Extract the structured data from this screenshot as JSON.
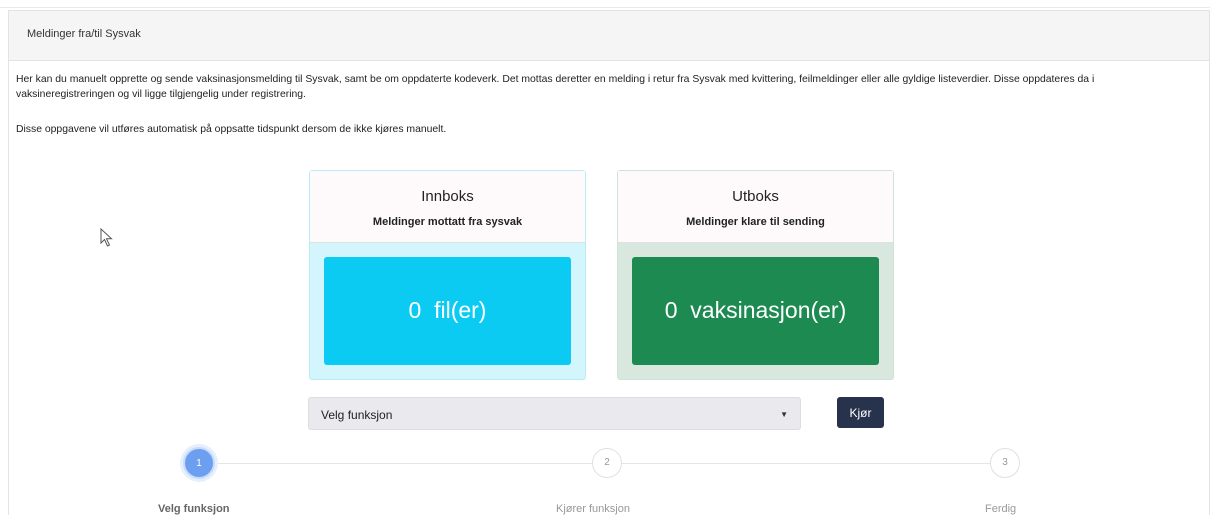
{
  "panel": {
    "title": "Meldinger fra/til Sysvak"
  },
  "description": {
    "paragraph1": "Her kan du manuelt opprette og sende vaksinasjonsmelding til Sysvak, samt be om oppdaterte kodeverk. Det mottas deretter en melding i retur fra Sysvak med kvittering, feilmeldinger eller alle gyldige listeverdier. Disse oppdateres da i vaksineregistreringen og vil ligge tilgjengelig under registrering.",
    "paragraph2": "Disse oppgavene vil utføres automatisk på oppsatte tidspunkt dersom de ikke kjøres manuelt."
  },
  "inbox": {
    "title": "Innboks",
    "subtitle": "Meldinger mottatt fra sysvak",
    "count_text": "0  fil(er)",
    "color": "#0ccbf3"
  },
  "outbox": {
    "title": "Utboks",
    "subtitle": "Meldinger klare til sending",
    "count_text": "0  vaksinasjon(er)",
    "color": "#1d8a52"
  },
  "function_select": {
    "selected": "Velg funksjon"
  },
  "run_button": {
    "label": "Kjør"
  },
  "stepper": {
    "active_color": "#6d9ff0",
    "steps": [
      {
        "number": "1",
        "label": "Velg funksjon"
      },
      {
        "number": "2",
        "label": "Kjører funksjon"
      },
      {
        "number": "3",
        "label": "Ferdig"
      }
    ]
  }
}
